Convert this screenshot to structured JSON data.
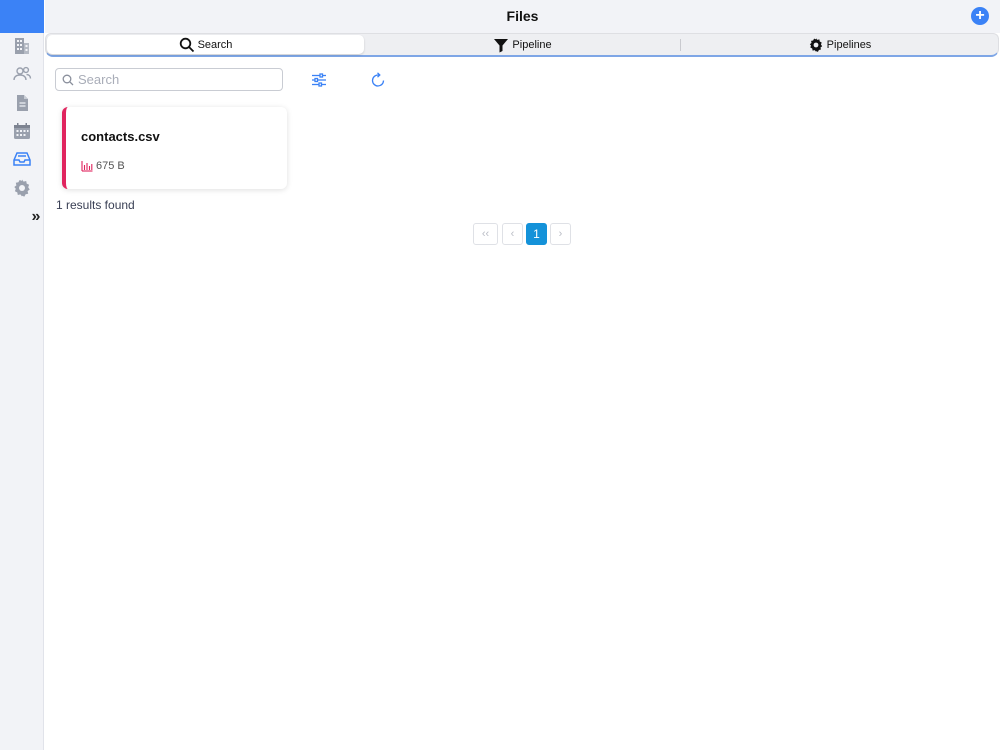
{
  "header": {
    "title": "Files",
    "add_label": "+"
  },
  "sidebar": {
    "items": [
      {
        "icon": "building-icon"
      },
      {
        "icon": "users-icon"
      },
      {
        "icon": "document-icon"
      },
      {
        "icon": "calendar-icon"
      },
      {
        "icon": "inbox-icon",
        "active": true
      },
      {
        "icon": "gear-icon"
      }
    ],
    "expand_label": "»"
  },
  "tabs": [
    {
      "label": "Search",
      "icon": "search-icon",
      "active": true
    },
    {
      "label": "Pipeline",
      "icon": "filter-icon"
    },
    {
      "label": "Pipelines",
      "icon": "gear-icon"
    }
  ],
  "search": {
    "placeholder": "Search",
    "value": ""
  },
  "files": [
    {
      "name": "contacts.csv",
      "size": "675 B"
    }
  ],
  "results_text": "1 results found",
  "pagination": {
    "first": "‹‹",
    "prev": "‹",
    "current": "1",
    "next": "›"
  },
  "colors": {
    "accent": "#3b82f6",
    "card_border": "#e0245e",
    "pager_active": "#1492d9"
  }
}
